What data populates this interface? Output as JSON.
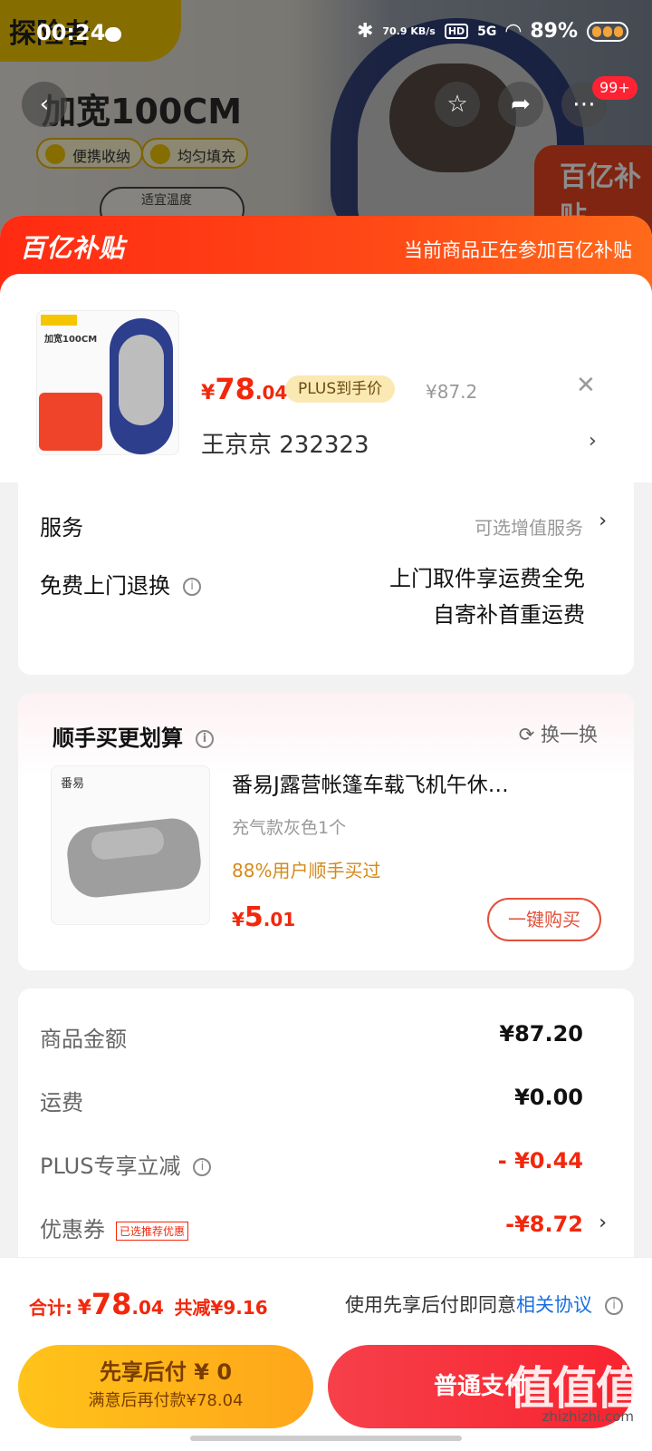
{
  "status_bar": {
    "time": "00:24",
    "net_speed": "70.9 KB/s",
    "hd": "HD",
    "signal": "5G",
    "battery": "89%"
  },
  "background": {
    "logo_text": "探险者",
    "title": "加宽100CM",
    "chip1": "便携收纳",
    "chip2": "均匀填充",
    "chip3": "适宜温度",
    "badge": "百亿补贴",
    "cart_count": "99+"
  },
  "banner": {
    "brand": "百亿补贴",
    "note": "当前商品正在参加百亿补贴"
  },
  "product": {
    "price_symbol": "¥",
    "price_int": "78",
    "price_dec": ".04",
    "plus_tag": "PLUS到手价",
    "original_price": "¥87.2",
    "buyer": "王京京  232323"
  },
  "service": {
    "label": "服务",
    "value": "可选增值服务",
    "return_label": "免费上门退换",
    "return_line1": "上门取件享运费全免",
    "return_line2": "自寄补首重运费"
  },
  "addon": {
    "heading": "顺手买更划算",
    "swap": "换一换",
    "brand": "番易",
    "title": "番易J露营帐篷车载飞机午休…",
    "spec": "充气款灰色1个",
    "bought": "88%用户顺手买过",
    "price_symbol": "¥",
    "price_int": "5",
    "price_dec": ".01",
    "buy_button": "一键购买"
  },
  "summary": {
    "goods_label": "商品金额",
    "goods_value": "¥87.20",
    "shipping_label": "运费",
    "shipping_value": "¥0.00",
    "plus_label": "PLUS专享立减",
    "plus_value": "- ¥0.44",
    "coupon_label": "优惠券",
    "coupon_tag": "已选推荐优惠",
    "coupon_value": "-¥8.72"
  },
  "bottom": {
    "total_label": "合计:",
    "total_symbol": "¥",
    "total_int": "78",
    "total_dec": ".04",
    "total_save": "共减¥9.16",
    "agree_text": "使用先享后付即同意",
    "agree_link": "相关协议",
    "pay_later_main": "先享后付 ¥ 0",
    "pay_later_sub": "满意后再付款¥78.04",
    "pay_now": "普通支付",
    "watermark": "值值值",
    "watermark_url": "zhizhizhi.com"
  },
  "colors": {
    "accent": "#f2270c",
    "banner": "#ff3b14",
    "pay_later": "#ffb81a",
    "pay_now": "#f6303a",
    "link": "#1a6fe0"
  }
}
